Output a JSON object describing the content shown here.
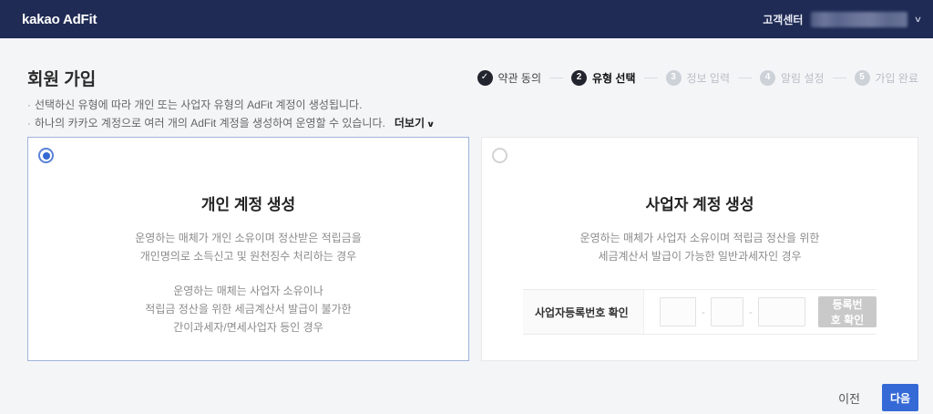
{
  "navbar": {
    "logo": "kakao AdFit",
    "help_label": "고객센터"
  },
  "icons": {
    "chevron_down": "∨",
    "check": "✓",
    "bullet": "·",
    "dash": "-"
  },
  "header": {
    "title": "회원 가입"
  },
  "steps": [
    {
      "num": "✓",
      "label": "약관 동의",
      "state": "done"
    },
    {
      "num": "2",
      "label": "유형 선택",
      "state": "active"
    },
    {
      "num": "3",
      "label": "정보 입력",
      "state": "todo"
    },
    {
      "num": "4",
      "label": "알림 설정",
      "state": "todo"
    },
    {
      "num": "5",
      "label": "가입 완료",
      "state": "todo"
    }
  ],
  "intro": {
    "line1": "선택하신 유형에 따라 개인 또는 사업자 유형의 AdFit 계정이 생성됩니다.",
    "line2": "하나의 카카오 계정으로 여러 개의 AdFit 계정을 생성하여 운영할 수 있습니다.",
    "more_label": "더보기"
  },
  "personal_card": {
    "selected": true,
    "title": "개인 계정 생성",
    "para1": [
      "운영하는 매체가 개인 소유이며 정산받은 적립금을",
      "개인명의로 소득신고 및 원천징수 처리하는 경우"
    ],
    "para2": [
      "운영하는 매체는 사업자 소유이나",
      "적립금 정산을 위한 세금계산서 발급이 불가한",
      "간이과세자/면세사업자 등인 경우"
    ]
  },
  "business_card": {
    "selected": false,
    "title": "사업자 계정 생성",
    "para1": [
      "운영하는 매체가 사업자 소유이며 적립금 정산을 위한",
      "세금계산서 발급이 가능한 일반과세자인 경우"
    ],
    "reg_label": "사업자등록번호 확인",
    "reg_inputs": [
      "",
      "",
      ""
    ],
    "verify_button": "등록번호 확인"
  },
  "footer": {
    "prev_label": "이전",
    "next_label": "다음"
  },
  "colors": {
    "navbar_bg": "#1f2b55",
    "accent_blue": "#3569d6",
    "radio_blue": "#3468d2",
    "selected_card_border": "#9fb3d9",
    "step_done_bg": "#22252e",
    "step_todo_bg": "#cdd1d8",
    "disabled_button_bg": "#c9c9c9"
  }
}
